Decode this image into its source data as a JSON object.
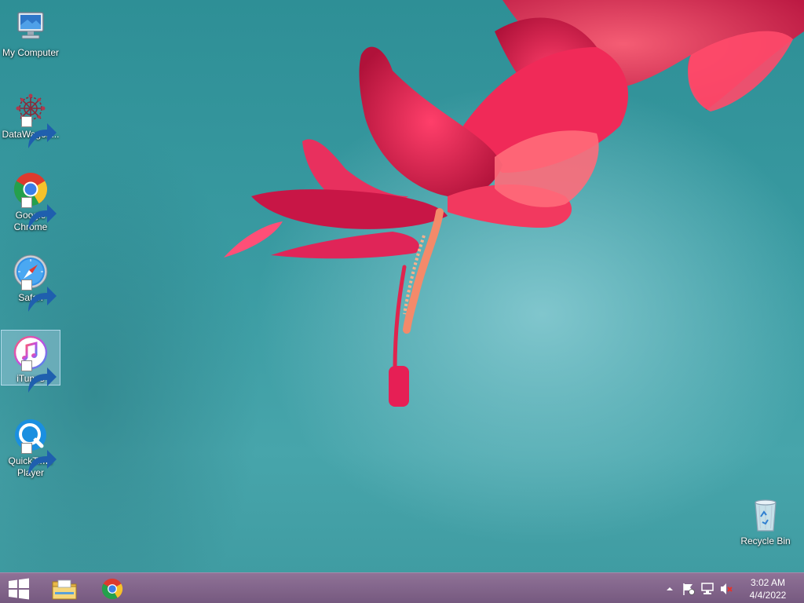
{
  "desktop": {
    "icons": [
      {
        "id": "my-computer",
        "label": "My Computer",
        "icon": "computer-icon",
        "shortcut": false,
        "selected": false
      },
      {
        "id": "datawagon",
        "label": "DataWagon...",
        "icon": "datawagon-icon",
        "shortcut": true,
        "selected": false
      },
      {
        "id": "google-chrome",
        "label": "Google Chrome",
        "icon": "chrome-icon",
        "shortcut": true,
        "selected": false
      },
      {
        "id": "safari",
        "label": "Safari",
        "icon": "safari-icon",
        "shortcut": true,
        "selected": false
      },
      {
        "id": "itunes",
        "label": "iTunes",
        "icon": "itunes-icon",
        "shortcut": true,
        "selected": true
      },
      {
        "id": "quicktime-player",
        "label": "QuickTime Player",
        "icon": "quicktime-icon",
        "shortcut": true,
        "selected": false
      }
    ],
    "recycle_bin": {
      "label": "Recycle Bin",
      "icon": "recycle-bin-icon"
    }
  },
  "taskbar": {
    "start": {
      "icon": "windows-start-icon"
    },
    "pinned": [
      {
        "id": "file-explorer",
        "icon": "file-explorer-icon"
      },
      {
        "id": "chrome",
        "icon": "chrome-icon"
      }
    ],
    "tray": {
      "icons": [
        "show-hidden-icons-arrow-icon",
        "action-center-flag-icon",
        "network-icon",
        "volume-muted-icon"
      ],
      "time": "3:02 AM",
      "date": "4/4/2022"
    }
  },
  "colors": {
    "taskbar": "#7a567d",
    "desktop_teal": "#3a9ba2",
    "flower": "#e0245a",
    "selection": "#c8e1f5"
  }
}
